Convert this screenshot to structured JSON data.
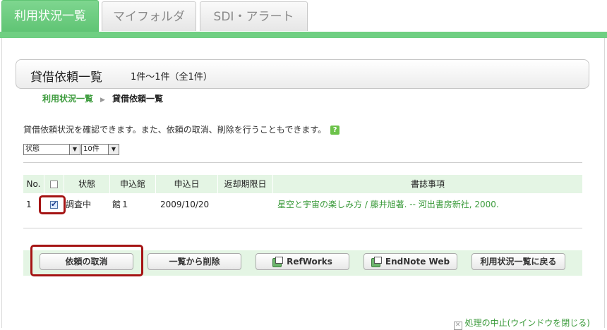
{
  "tabs": [
    {
      "label": "利用状況一覧",
      "active": true
    },
    {
      "label": "マイフォルダ",
      "active": false
    },
    {
      "label": "SDI・アラート",
      "active": false
    }
  ],
  "header": {
    "title": "貸借依頼一覧",
    "count": "1件～1件（全1件）"
  },
  "breadcrumb": {
    "parent": "利用状況一覧",
    "current": "貸借依頼一覧"
  },
  "intro_text": "貸借依頼状況を確認できます。また、依頼の取消、削除を行うこともできます。",
  "help_icon": "?",
  "filters": {
    "status_select": "状態",
    "per_page_select": "10件"
  },
  "table": {
    "headers": [
      "No.",
      "",
      "状態",
      "申込館",
      "申込日",
      "返却期限日",
      "書誌事項"
    ],
    "rows": [
      {
        "no": "1",
        "checked": true,
        "status": "調査中",
        "library": "館１",
        "applied": "2009/10/20",
        "due": "",
        "citation": "星空と宇宙の楽しみ方 / 藤井旭著. -- 河出書房新社, 2000."
      }
    ]
  },
  "buttons": {
    "cancel": "依頼の取消",
    "delete": "一覧から削除",
    "refworks": "RefWorks",
    "endnote": "EndNote Web",
    "back": "利用状況一覧に戻る"
  },
  "footer_link": "処理の中止(ウインドウを閉じる)",
  "colors": {
    "accent": "#6fcf82",
    "highlight": "#a51414",
    "link": "#3a9a3a",
    "panel": "#e4f5e4"
  }
}
